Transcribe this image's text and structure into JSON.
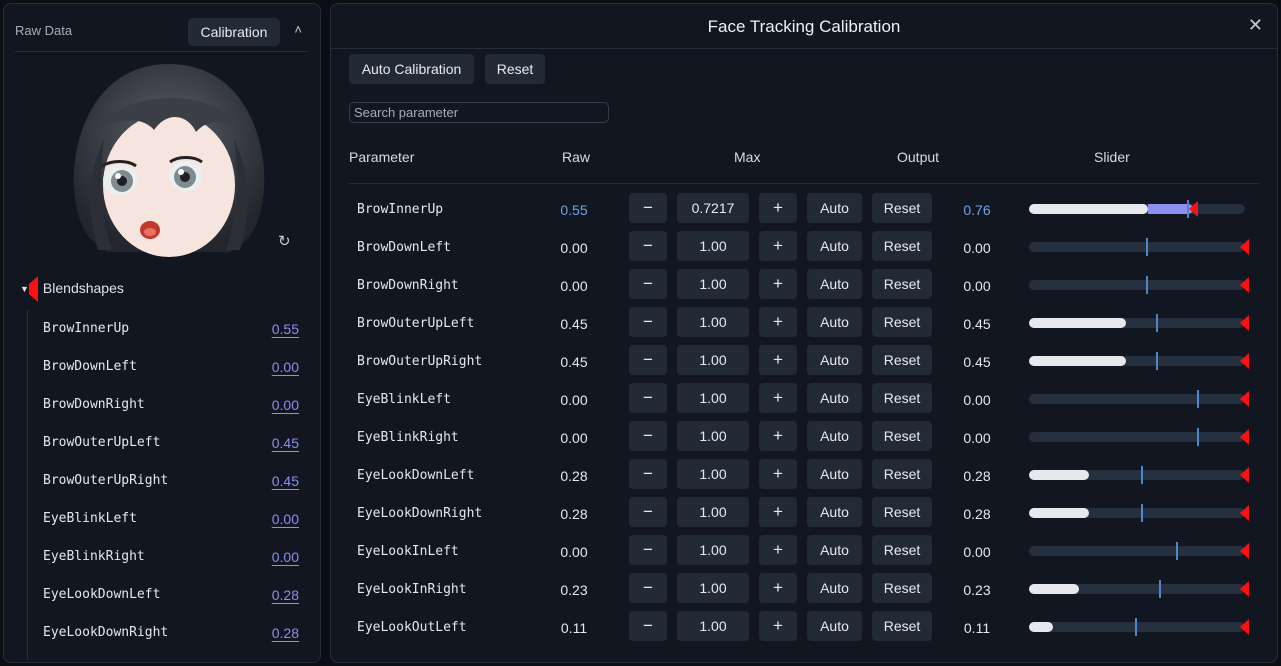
{
  "left": {
    "title": "Raw Data",
    "calibration_button": "Calibration",
    "section_label": "Blendshapes",
    "items": [
      {
        "name": "BrowInnerUp",
        "value": "0.55"
      },
      {
        "name": "BrowDownLeft",
        "value": "0.00"
      },
      {
        "name": "BrowDownRight",
        "value": "0.00"
      },
      {
        "name": "BrowOuterUpLeft",
        "value": "0.45"
      },
      {
        "name": "BrowOuterUpRight",
        "value": "0.45"
      },
      {
        "name": "EyeBlinkLeft",
        "value": "0.00"
      },
      {
        "name": "EyeBlinkRight",
        "value": "0.00"
      },
      {
        "name": "EyeLookDownLeft",
        "value": "0.28"
      },
      {
        "name": "EyeLookDownRight",
        "value": "0.28"
      }
    ]
  },
  "dialog": {
    "title": "Face Tracking Calibration",
    "auto_calibration": "Auto Calibration",
    "reset": "Reset",
    "search_placeholder": "Search parameter",
    "columns": {
      "parameter": "Parameter",
      "raw": "Raw",
      "max": "Max",
      "output": "Output",
      "slider": "Slider"
    },
    "minus_glyph": "−",
    "plus_glyph": "+",
    "auto_label": "Auto",
    "reset_label": "Reset",
    "rows": [
      {
        "name": "BrowInnerUp",
        "raw": "0.55",
        "max": "0.7217",
        "output": "0.76",
        "raw_level": 0.55,
        "output_level": 0.76,
        "marker": 0.73,
        "handle": 0.76,
        "active": true
      },
      {
        "name": "BrowDownLeft",
        "raw": "0.00",
        "max": "1.00",
        "output": "0.00",
        "raw_level": 0.0,
        "output_level": 0.0,
        "marker": 0.54,
        "handle": 1.0,
        "active": false
      },
      {
        "name": "BrowDownRight",
        "raw": "0.00",
        "max": "1.00",
        "output": "0.00",
        "raw_level": 0.0,
        "output_level": 0.0,
        "marker": 0.54,
        "handle": 1.0,
        "active": false
      },
      {
        "name": "BrowOuterUpLeft",
        "raw": "0.45",
        "max": "1.00",
        "output": "0.45",
        "raw_level": 0.45,
        "output_level": 0.45,
        "marker": 0.59,
        "handle": 1.0,
        "active": false
      },
      {
        "name": "BrowOuterUpRight",
        "raw": "0.45",
        "max": "1.00",
        "output": "0.45",
        "raw_level": 0.45,
        "output_level": 0.45,
        "marker": 0.59,
        "handle": 1.0,
        "active": false
      },
      {
        "name": "EyeBlinkLeft",
        "raw": "0.00",
        "max": "1.00",
        "output": "0.00",
        "raw_level": 0.0,
        "output_level": 0.0,
        "marker": 0.78,
        "handle": 1.0,
        "active": false
      },
      {
        "name": "EyeBlinkRight",
        "raw": "0.00",
        "max": "1.00",
        "output": "0.00",
        "raw_level": 0.0,
        "output_level": 0.0,
        "marker": 0.78,
        "handle": 1.0,
        "active": false
      },
      {
        "name": "EyeLookDownLeft",
        "raw": "0.28",
        "max": "1.00",
        "output": "0.28",
        "raw_level": 0.28,
        "output_level": 0.28,
        "marker": 0.52,
        "handle": 1.0,
        "active": false
      },
      {
        "name": "EyeLookDownRight",
        "raw": "0.28",
        "max": "1.00",
        "output": "0.28",
        "raw_level": 0.28,
        "output_level": 0.28,
        "marker": 0.52,
        "handle": 1.0,
        "active": false
      },
      {
        "name": "EyeLookInLeft",
        "raw": "0.00",
        "max": "1.00",
        "output": "0.00",
        "raw_level": 0.0,
        "output_level": 0.0,
        "marker": 0.68,
        "handle": 1.0,
        "active": false
      },
      {
        "name": "EyeLookInRight",
        "raw": "0.23",
        "max": "1.00",
        "output": "0.23",
        "raw_level": 0.23,
        "output_level": 0.23,
        "marker": 0.6,
        "handle": 1.0,
        "active": false
      },
      {
        "name": "EyeLookOutLeft",
        "raw": "0.11",
        "max": "1.00",
        "output": "0.11",
        "raw_level": 0.11,
        "output_level": 0.11,
        "marker": 0.49,
        "handle": 1.0,
        "active": false
      }
    ]
  },
  "colors": {
    "accent": "#6ea3e8",
    "handle": "#ff1010",
    "overshoot": "#8b8ff0"
  }
}
